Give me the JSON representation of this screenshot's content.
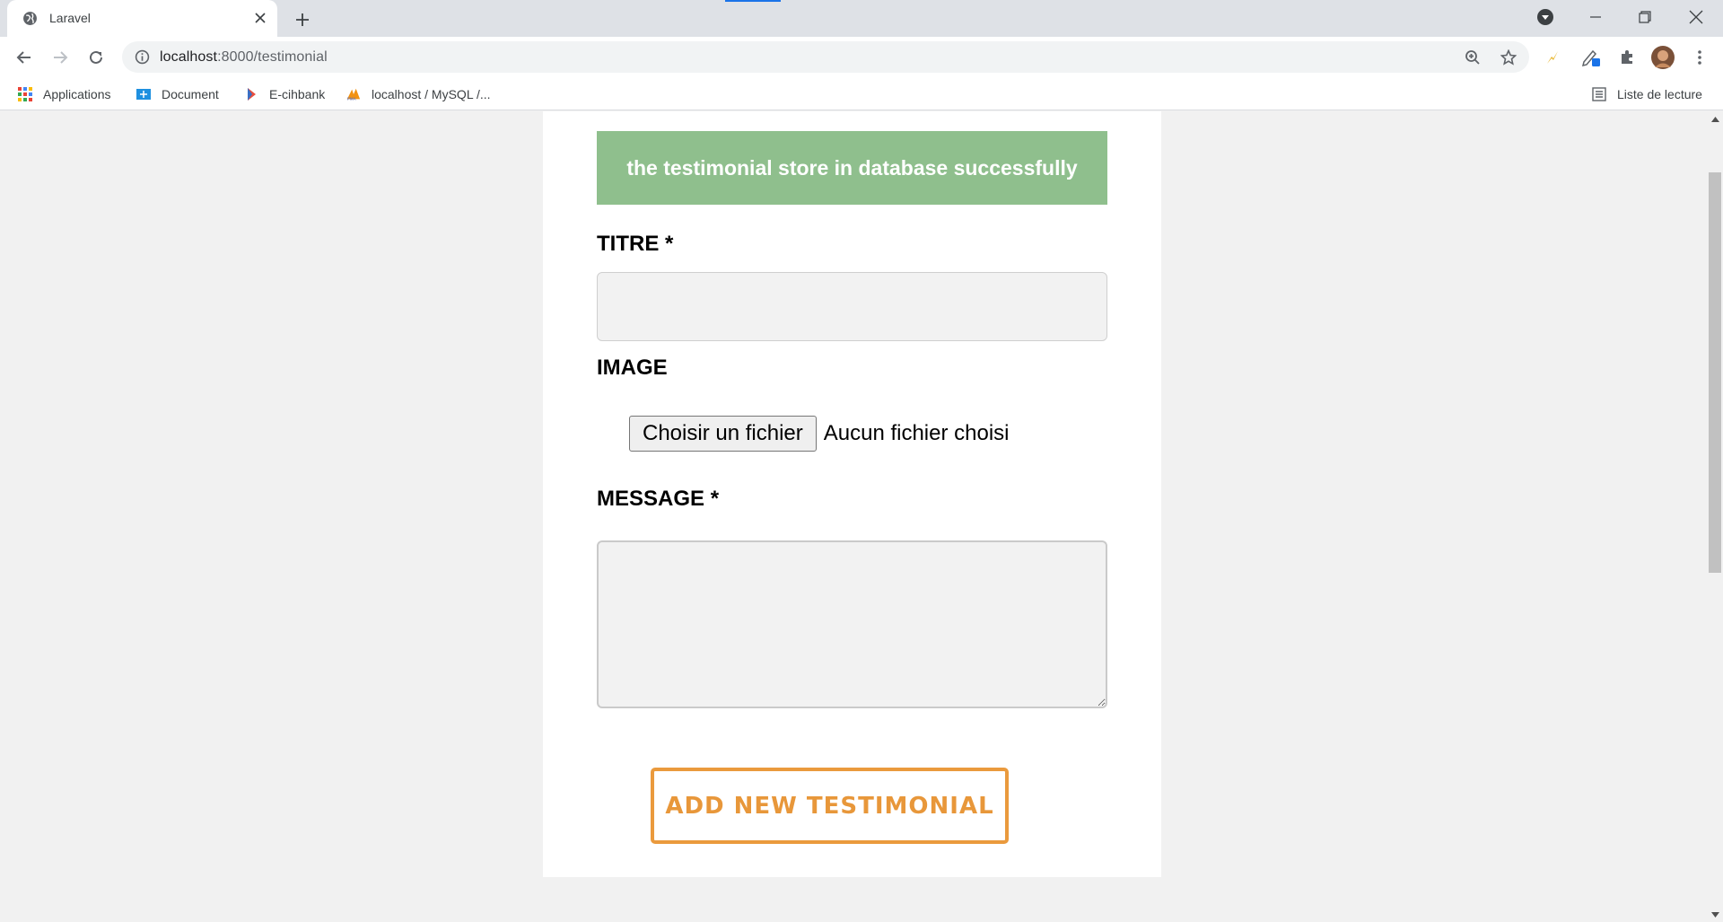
{
  "browser": {
    "tab_title": "Laravel",
    "url_host": "localhost",
    "url_path": ":8000/testimonial",
    "bookmarks": [
      "Applications",
      "Document",
      "E-cihbank",
      "localhost / MySQL /..."
    ],
    "reading_list": "Liste de lecture",
    "icons": [
      "globe-icon",
      "close-icon",
      "plus-icon",
      "back-icon",
      "forward-icon",
      "reload-icon",
      "info-icon",
      "zoom-icon",
      "star-icon",
      "extension-icon",
      "menu-icon",
      "minimize-icon",
      "restore-icon"
    ]
  },
  "page": {
    "alert": "the testimonial store in database successfully",
    "titre_label": "TITRE *",
    "titre_value": "",
    "image_label": "IMAGE",
    "file_button": "Choisir un fichier",
    "file_status": "Aucun fichier choisi",
    "message_label": "MESSAGE *",
    "message_value": "",
    "submit_label": "ADD NEW TESTIMONIAL"
  },
  "colors": {
    "alert_bg": "#8fbf8d",
    "submit_accent": "#ea9a3d",
    "page_bg": "#f1f1f1"
  }
}
